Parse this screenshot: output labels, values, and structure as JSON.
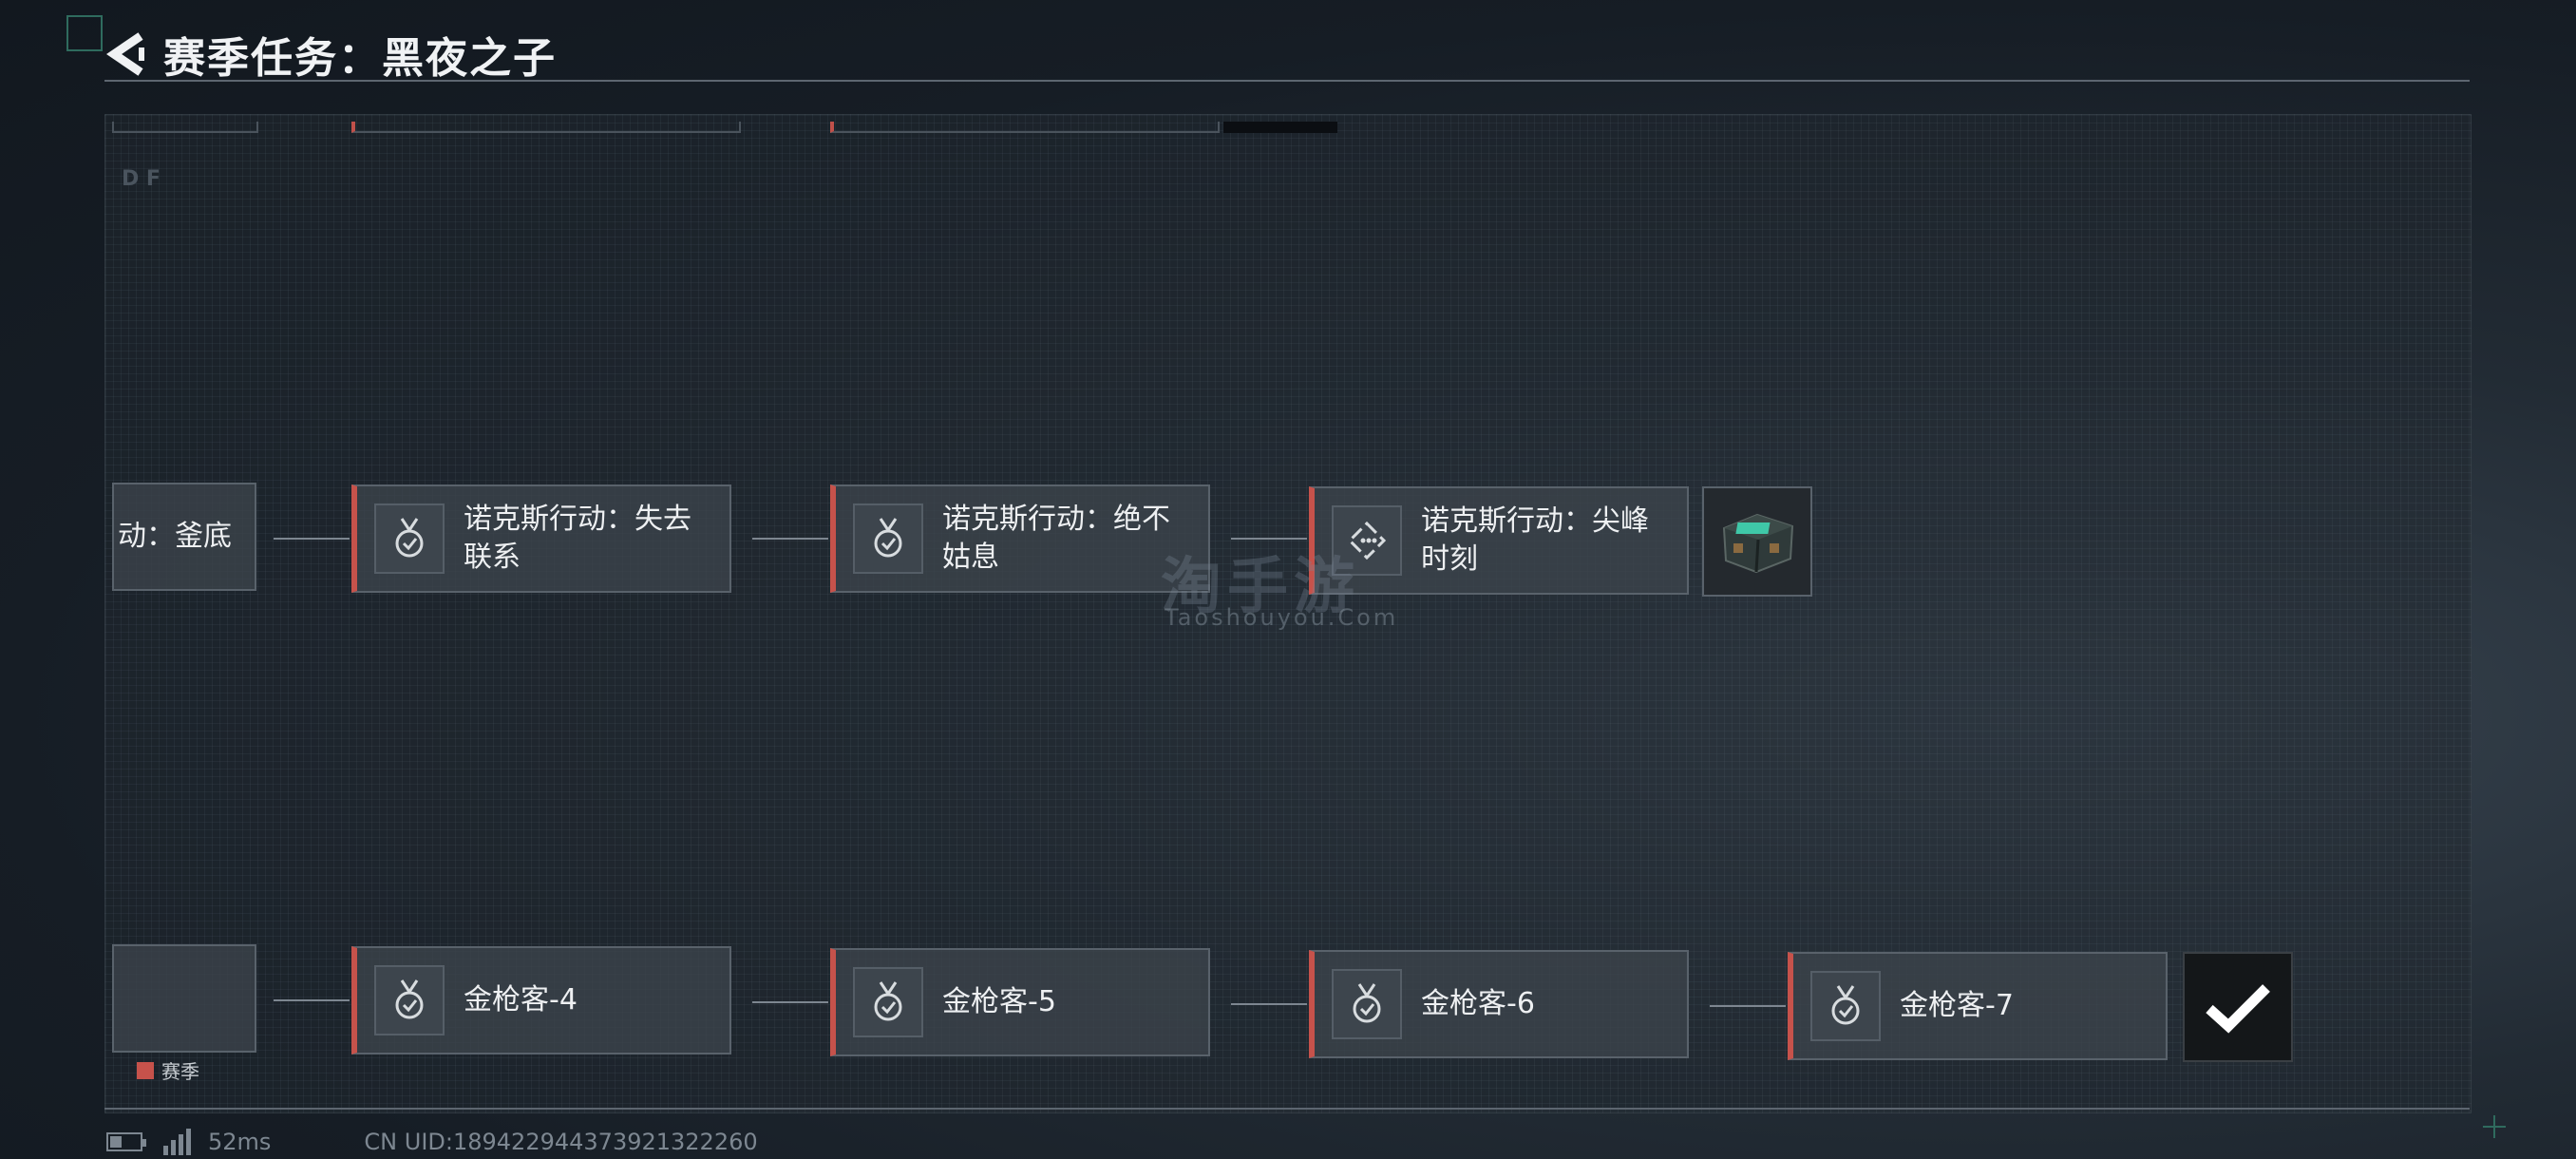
{
  "header": {
    "title": "赛季任务：黑夜之子"
  },
  "nodes_row1": [
    {
      "label": "动：釜底",
      "status": "completed"
    },
    {
      "label": "诺克斯行动：失去\n联系",
      "status": "completed"
    },
    {
      "label": "诺克斯行动：绝不\n姑息",
      "status": "completed"
    },
    {
      "label": "诺克斯行动：尖峰\n时刻",
      "status": "in-progress"
    }
  ],
  "nodes_row2": [
    {
      "label": "",
      "status": "completed"
    },
    {
      "label": "金枪客-4",
      "status": "completed"
    },
    {
      "label": "金枪客-5",
      "status": "completed"
    },
    {
      "label": "金枪客-6",
      "status": "completed"
    },
    {
      "label": "金枪客-7",
      "status": "completed"
    }
  ],
  "rewards": [
    {
      "name": "supply-crate",
      "claimed": false
    },
    {
      "name": "reward-claimed",
      "claimed": true
    }
  ],
  "legend": {
    "label": "赛季",
    "color": "#c6524b"
  },
  "status_bar": {
    "ping": "52ms",
    "uid": "CN UID:18942294437392132226​0"
  },
  "watermark": {
    "cn": "淘手游",
    "en": "Taoshouyou.Com"
  },
  "icons": {
    "back": "back-arrow-icon",
    "completed": "medal-check-icon",
    "in-progress": "diamond-dots-icon"
  },
  "colors": {
    "accent_red": "#c6524b",
    "panel_grid": "#2a333c"
  }
}
